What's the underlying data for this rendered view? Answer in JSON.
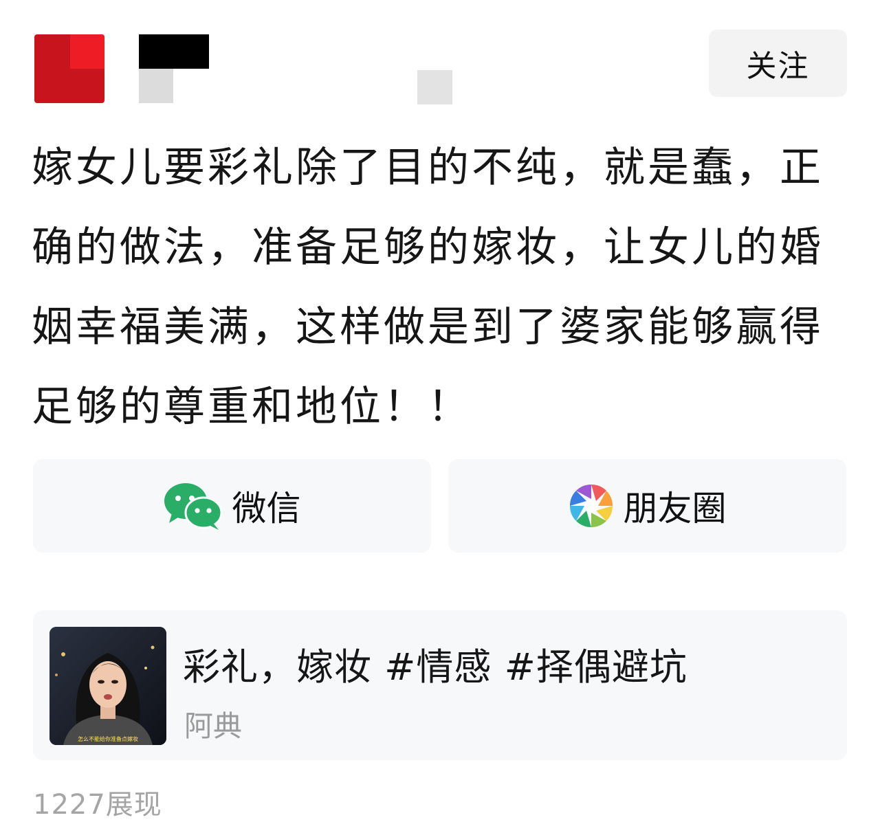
{
  "header": {
    "follow_label": "关注"
  },
  "post": {
    "text": "嫁女儿要彩礼除了目的不纯，就是蠢，正确的做法，准备足够的嫁妆，让女儿的婚姻幸福美满，这样做是到了婆家能够赢得足够的尊重和地位！！"
  },
  "share": {
    "wechat_label": "微信",
    "moments_label": "朋友圈"
  },
  "video": {
    "title": "彩礼，嫁妆 #情感 #择偶避坑",
    "author": "阿典",
    "subtitle": "怎么不能给你准备点嫁妆"
  },
  "stats": {
    "impressions": "1227展现"
  },
  "colors": {
    "wechat_green": "#2aae67",
    "button_bg": "#f7f8fa",
    "follow_bg": "#f3f3f3",
    "secondary_text": "#9a9a9a"
  }
}
